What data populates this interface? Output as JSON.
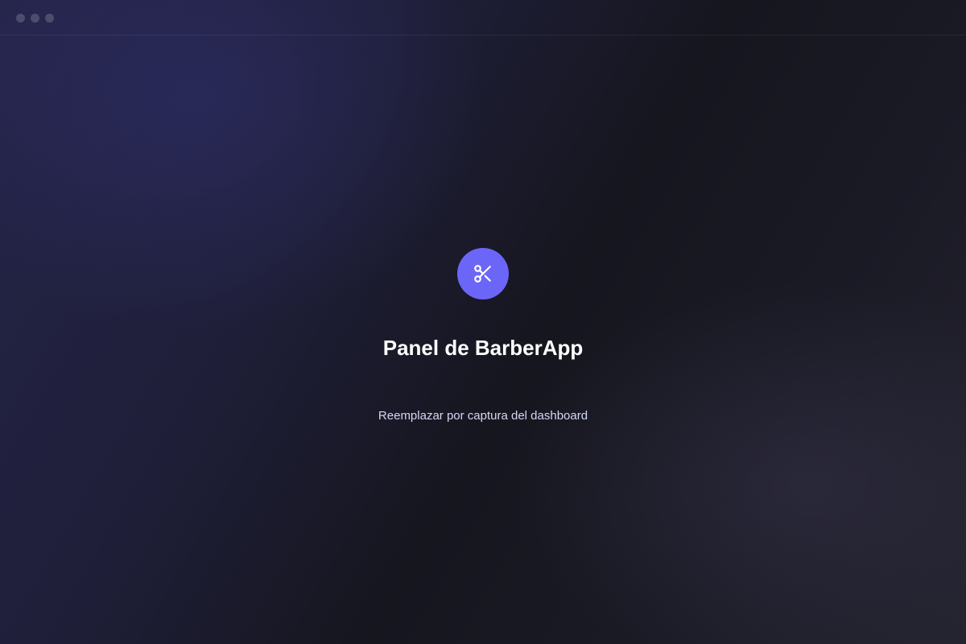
{
  "window": {
    "controls": [
      "dot",
      "dot",
      "dot"
    ]
  },
  "placeholder": {
    "icon": "scissors-icon",
    "title": "Panel de BarberApp",
    "subtitle": "Reemplazar por captura del dashboard"
  },
  "colors": {
    "accent": "#6b66f7",
    "icon_stroke": "#ffffff",
    "title": "#ffffff",
    "subtitle": "#d4d8f4",
    "background_dark": "#15151f",
    "background_tint": "#242448"
  }
}
